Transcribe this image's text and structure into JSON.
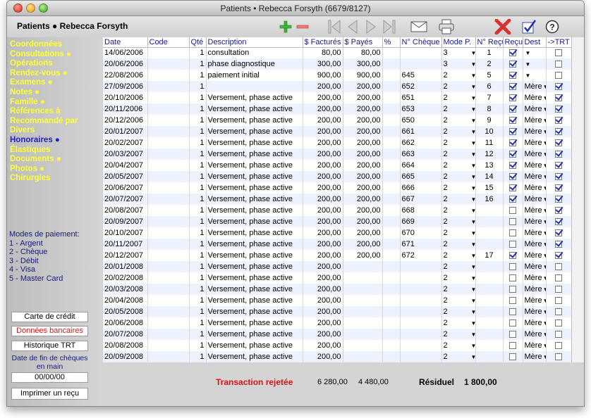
{
  "window": {
    "title": "Patients • Rebecca Forsyth (6679/8127)"
  },
  "header": {
    "title": "Patients ● Rebecca Forsyth"
  },
  "toolbar": {
    "icons": [
      "add-icon",
      "remove-icon",
      "first-record-icon",
      "previous-record-icon",
      "next-record-icon",
      "last-record-icon",
      "email-icon",
      "print-icon",
      "delete-icon",
      "validate-icon",
      "help-icon"
    ],
    "help_label": "?"
  },
  "sidebar": {
    "items": [
      {
        "label": "Coordonnées",
        "active": false
      },
      {
        "label": "Consultations ●",
        "active": false
      },
      {
        "label": "Opérations",
        "active": false
      },
      {
        "label": "Rendez-vous ●",
        "active": false
      },
      {
        "label": "Examens ●",
        "active": false
      },
      {
        "label": "Notes ●",
        "active": false
      },
      {
        "label": "Famille ●",
        "active": false
      },
      {
        "label": "Références à",
        "active": false
      },
      {
        "label": "Recommandé par",
        "active": false
      },
      {
        "label": "Divers",
        "active": false
      },
      {
        "label": "Honoraires ●",
        "active": true
      },
      {
        "label": "Élastiques",
        "active": false
      },
      {
        "label": "Documents ●",
        "active": false
      },
      {
        "label": "Photos ●",
        "active": false
      },
      {
        "label": "Chirurgies",
        "active": false
      }
    ],
    "payment_modes_title": "Modes de paiement:",
    "payment_modes": [
      "1 - Argent",
      "2 - Chèque",
      "3 - Débit",
      "4 - Visa",
      "5 - Master Card"
    ],
    "btn_credit_card": "Carte de crédit",
    "btn_bank_data": "Données bancaires",
    "btn_trt_history": "Historique TRT",
    "date_label": "Date de fin de chèques en main",
    "date_value": "00/00/00",
    "btn_print_receipt": "Imprimer un reçu"
  },
  "colors": {
    "nav_text": "#ffff33",
    "nav_active": "#2222cc",
    "bank_button_text": "#dd1111",
    "rejected_text": "#dd1111",
    "row_alt": "#edf3fe"
  },
  "table": {
    "headers": [
      "Date",
      "Code",
      "Qté",
      "Description",
      "$ Facturés",
      "$ Payés",
      "%",
      "N° Chèque",
      "Mode P.",
      "N° Reçu",
      "Reçu",
      "Dest",
      "->TRT"
    ],
    "rows": [
      {
        "date": "14/06/2006",
        "code": "",
        "qty": "1",
        "desc": "consultation",
        "billed": "80,00",
        "paid": "80,00",
        "pct": "",
        "cheque": "",
        "mode": "3",
        "receipt_no": "1",
        "received": true,
        "dest": "",
        "trt": false
      },
      {
        "date": "20/06/2006",
        "code": "",
        "qty": "1",
        "desc": "phase diagnostique",
        "billed": "300,00",
        "paid": "300,00",
        "pct": "",
        "cheque": "",
        "mode": "3",
        "receipt_no": "2",
        "received": true,
        "dest": "",
        "trt": false
      },
      {
        "date": "22/08/2006",
        "code": "",
        "qty": "1",
        "desc": "paiement initial",
        "billed": "900,00",
        "paid": "900,00",
        "pct": "",
        "cheque": "645",
        "mode": "2",
        "receipt_no": "5",
        "received": true,
        "dest": "",
        "trt": false
      },
      {
        "date": "27/09/2006",
        "code": "",
        "qty": "1",
        "desc": "",
        "billed": "200,00",
        "paid": "200,00",
        "pct": "",
        "cheque": "652",
        "mode": "2",
        "receipt_no": "6",
        "received": true,
        "dest": "Mère",
        "trt": true
      },
      {
        "date": "20/10/2006",
        "code": "",
        "qty": "1",
        "desc": "Versement, phase active",
        "billed": "200,00",
        "paid": "200,00",
        "pct": "",
        "cheque": "651",
        "mode": "2",
        "receipt_no": "7",
        "received": true,
        "dest": "Mère",
        "trt": true
      },
      {
        "date": "20/11/2006",
        "code": "",
        "qty": "1",
        "desc": "Versement, phase active",
        "billed": "200,00",
        "paid": "200,00",
        "pct": "",
        "cheque": "653",
        "mode": "2",
        "receipt_no": "8",
        "received": true,
        "dest": "Mère",
        "trt": true
      },
      {
        "date": "20/12/2006",
        "code": "",
        "qty": "1",
        "desc": "Versement, phase active",
        "billed": "200,00",
        "paid": "200,00",
        "pct": "",
        "cheque": "650",
        "mode": "2",
        "receipt_no": "9",
        "received": true,
        "dest": "Mère",
        "trt": true
      },
      {
        "date": "20/01/2007",
        "code": "",
        "qty": "1",
        "desc": "Versement, phase active",
        "billed": "200,00",
        "paid": "200,00",
        "pct": "",
        "cheque": "661",
        "mode": "2",
        "receipt_no": "10",
        "received": true,
        "dest": "Mère",
        "trt": true
      },
      {
        "date": "20/02/2007",
        "code": "",
        "qty": "1",
        "desc": "Versement, phase active",
        "billed": "200,00",
        "paid": "200,00",
        "pct": "",
        "cheque": "662",
        "mode": "2",
        "receipt_no": "11",
        "received": true,
        "dest": "Mère",
        "trt": true
      },
      {
        "date": "20/03/2007",
        "code": "",
        "qty": "1",
        "desc": "Versement, phase active",
        "billed": "200,00",
        "paid": "200,00",
        "pct": "",
        "cheque": "663",
        "mode": "2",
        "receipt_no": "12",
        "received": true,
        "dest": "Mère",
        "trt": true
      },
      {
        "date": "20/04/2007",
        "code": "",
        "qty": "1",
        "desc": "Versement, phase active",
        "billed": "200,00",
        "paid": "200,00",
        "pct": "",
        "cheque": "664",
        "mode": "2",
        "receipt_no": "13",
        "received": true,
        "dest": "Mère",
        "trt": true
      },
      {
        "date": "20/05/2007",
        "code": "",
        "qty": "1",
        "desc": "Versement, phase active",
        "billed": "200,00",
        "paid": "200,00",
        "pct": "",
        "cheque": "665",
        "mode": "2",
        "receipt_no": "14",
        "received": true,
        "dest": "Mère",
        "trt": true
      },
      {
        "date": "20/06/2007",
        "code": "",
        "qty": "1",
        "desc": "Versement, phase active",
        "billed": "200,00",
        "paid": "200,00",
        "pct": "",
        "cheque": "666",
        "mode": "2",
        "receipt_no": "15",
        "received": true,
        "dest": "Mère",
        "trt": true
      },
      {
        "date": "20/07/2007",
        "code": "",
        "qty": "1",
        "desc": "Versement, phase active",
        "billed": "200,00",
        "paid": "200,00",
        "pct": "",
        "cheque": "667",
        "mode": "2",
        "receipt_no": "16",
        "received": true,
        "dest": "Mère",
        "trt": true
      },
      {
        "date": "20/08/2007",
        "code": "",
        "qty": "1",
        "desc": "Versement, phase active",
        "billed": "200,00",
        "paid": "200,00",
        "pct": "",
        "cheque": "668",
        "mode": "2",
        "receipt_no": "",
        "received": false,
        "dest": "Mère",
        "trt": true
      },
      {
        "date": "20/09/2007",
        "code": "",
        "qty": "1",
        "desc": "Versement, phase active",
        "billed": "200,00",
        "paid": "200,00",
        "pct": "",
        "cheque": "669",
        "mode": "2",
        "receipt_no": "",
        "received": false,
        "dest": "Mère",
        "trt": true
      },
      {
        "date": "20/10/2007",
        "code": "",
        "qty": "1",
        "desc": "Versement, phase active",
        "billed": "200,00",
        "paid": "200,00",
        "pct": "",
        "cheque": "670",
        "mode": "2",
        "receipt_no": "",
        "received": false,
        "dest": "Mère",
        "trt": true
      },
      {
        "date": "20/11/2007",
        "code": "",
        "qty": "1",
        "desc": "Versement, phase active",
        "billed": "200,00",
        "paid": "200,00",
        "pct": "",
        "cheque": "671",
        "mode": "2",
        "receipt_no": "",
        "received": false,
        "dest": "Mère",
        "trt": true
      },
      {
        "date": "20/12/2007",
        "code": "",
        "qty": "1",
        "desc": "Versement, phase active",
        "billed": "200,00",
        "paid": "200,00",
        "pct": "",
        "cheque": "672",
        "mode": "2",
        "receipt_no": "17",
        "received": true,
        "dest": "Mère",
        "trt": true
      },
      {
        "date": "20/01/2008",
        "code": "",
        "qty": "1",
        "desc": "Versement, phase active",
        "billed": "200,00",
        "paid": "",
        "pct": "",
        "cheque": "",
        "mode": "2",
        "receipt_no": "",
        "received": false,
        "dest": "Mère",
        "trt": false
      },
      {
        "date": "20/02/2008",
        "code": "",
        "qty": "1",
        "desc": "Versement, phase active",
        "billed": "200,00",
        "paid": "",
        "pct": "",
        "cheque": "",
        "mode": "2",
        "receipt_no": "",
        "received": false,
        "dest": "Mère",
        "trt": false
      },
      {
        "date": "20/03/2008",
        "code": "",
        "qty": "1",
        "desc": "Versement, phase active",
        "billed": "200,00",
        "paid": "",
        "pct": "",
        "cheque": "",
        "mode": "2",
        "receipt_no": "",
        "received": false,
        "dest": "Mère",
        "trt": false
      },
      {
        "date": "20/04/2008",
        "code": "",
        "qty": "1",
        "desc": "Versement, phase active",
        "billed": "200,00",
        "paid": "",
        "pct": "",
        "cheque": "",
        "mode": "2",
        "receipt_no": "",
        "received": false,
        "dest": "Mère",
        "trt": false
      },
      {
        "date": "20/05/2008",
        "code": "",
        "qty": "1",
        "desc": "Versement, phase active",
        "billed": "200,00",
        "paid": "",
        "pct": "",
        "cheque": "",
        "mode": "2",
        "receipt_no": "",
        "received": false,
        "dest": "Mère",
        "trt": false
      },
      {
        "date": "20/06/2008",
        "code": "",
        "qty": "1",
        "desc": "Versement, phase active",
        "billed": "200,00",
        "paid": "",
        "pct": "",
        "cheque": "",
        "mode": "2",
        "receipt_no": "",
        "received": false,
        "dest": "Mère",
        "trt": false
      },
      {
        "date": "20/07/2008",
        "code": "",
        "qty": "1",
        "desc": "Versement, phase active",
        "billed": "200,00",
        "paid": "",
        "pct": "",
        "cheque": "",
        "mode": "2",
        "receipt_no": "",
        "received": false,
        "dest": "Mère",
        "trt": false
      },
      {
        "date": "20/08/2008",
        "code": "",
        "qty": "1",
        "desc": "Versement, phase active",
        "billed": "200,00",
        "paid": "",
        "pct": "",
        "cheque": "",
        "mode": "2",
        "receipt_no": "",
        "received": false,
        "dest": "Mère",
        "trt": false
      },
      {
        "date": "20/09/2008",
        "code": "",
        "qty": "1",
        "desc": "Versement, phase active",
        "billed": "200,00",
        "paid": "",
        "pct": "",
        "cheque": "",
        "mode": "2",
        "receipt_no": "",
        "received": false,
        "dest": "Mère",
        "trt": false
      }
    ]
  },
  "footer": {
    "rejected_label": "Transaction rejetée",
    "total_billed": "6 280,00",
    "total_paid": "4 480,00",
    "residual_label": "Résiduel",
    "residual_value": "1 800,00"
  }
}
